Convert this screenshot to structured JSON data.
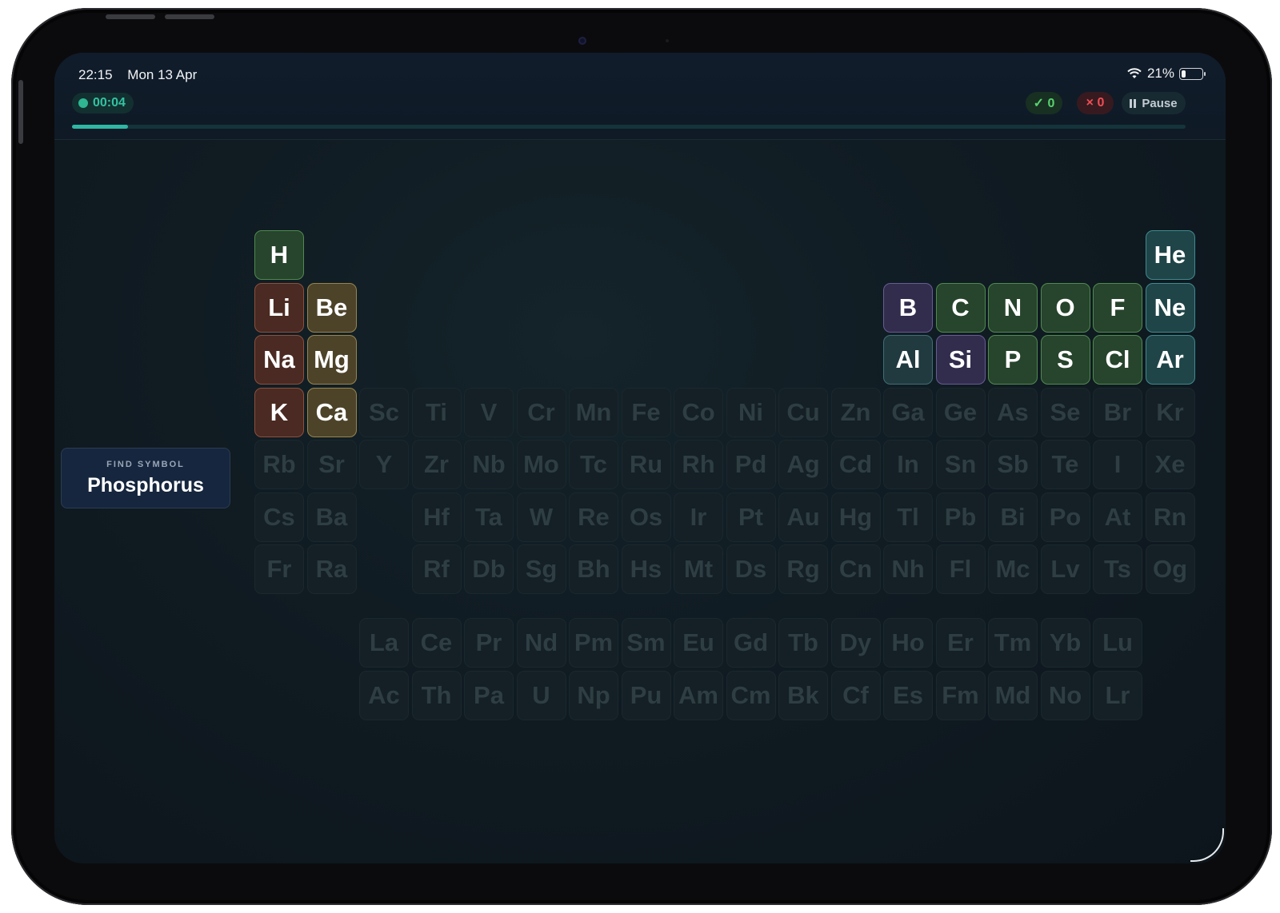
{
  "status": {
    "time": "22:15",
    "date": "Mon 13 Apr",
    "battery_percent": "21%",
    "battery_level": 0.21
  },
  "quiz": {
    "timer": "00:04",
    "correct": "✓ 0",
    "wrong": "× 0",
    "pause_label": "Pause",
    "progress": 0.05,
    "prompt_caption": "FIND SYMBOL",
    "prompt_name": "Phosphorus"
  },
  "colors": {
    "alkali": "#4a2a22",
    "alkaline_earth": "#4d4329",
    "nonmetal": "#27442c",
    "noble_gas": "#1f4548",
    "metalloid": "#322d4d",
    "post_transition": "#213a40",
    "accent": "#2fb7a3"
  },
  "elements": [
    {
      "s": "H",
      "r": 1,
      "c": 1,
      "cat": "nonm"
    },
    {
      "s": "He",
      "r": 1,
      "c": 18,
      "cat": "noble"
    },
    {
      "s": "Li",
      "r": 2,
      "c": 1,
      "cat": "alk"
    },
    {
      "s": "Be",
      "r": 2,
      "c": 2,
      "cat": "ae"
    },
    {
      "s": "B",
      "r": 2,
      "c": 13,
      "cat": "metalloid"
    },
    {
      "s": "C",
      "r": 2,
      "c": 14,
      "cat": "nonm"
    },
    {
      "s": "N",
      "r": 2,
      "c": 15,
      "cat": "nonm"
    },
    {
      "s": "O",
      "r": 2,
      "c": 16,
      "cat": "nonm"
    },
    {
      "s": "F",
      "r": 2,
      "c": 17,
      "cat": "nonm"
    },
    {
      "s": "Ne",
      "r": 2,
      "c": 18,
      "cat": "noble"
    },
    {
      "s": "Na",
      "r": 3,
      "c": 1,
      "cat": "alk"
    },
    {
      "s": "Mg",
      "r": 3,
      "c": 2,
      "cat": "ae"
    },
    {
      "s": "Al",
      "r": 3,
      "c": 13,
      "cat": "post"
    },
    {
      "s": "Si",
      "r": 3,
      "c": 14,
      "cat": "metalloid"
    },
    {
      "s": "P",
      "r": 3,
      "c": 15,
      "cat": "nonm"
    },
    {
      "s": "S",
      "r": 3,
      "c": 16,
      "cat": "nonm"
    },
    {
      "s": "Cl",
      "r": 3,
      "c": 17,
      "cat": "nonm"
    },
    {
      "s": "Ar",
      "r": 3,
      "c": 18,
      "cat": "noble"
    },
    {
      "s": "K",
      "r": 4,
      "c": 1,
      "cat": "alk"
    },
    {
      "s": "Ca",
      "r": 4,
      "c": 2,
      "cat": "ae"
    },
    {
      "s": "Sc",
      "r": 4,
      "c": 3,
      "cat": "ghost"
    },
    {
      "s": "Ti",
      "r": 4,
      "c": 4,
      "cat": "ghost"
    },
    {
      "s": "V",
      "r": 4,
      "c": 5,
      "cat": "ghost"
    },
    {
      "s": "Cr",
      "r": 4,
      "c": 6,
      "cat": "ghost"
    },
    {
      "s": "Mn",
      "r": 4,
      "c": 7,
      "cat": "ghost"
    },
    {
      "s": "Fe",
      "r": 4,
      "c": 8,
      "cat": "ghost"
    },
    {
      "s": "Co",
      "r": 4,
      "c": 9,
      "cat": "ghost"
    },
    {
      "s": "Ni",
      "r": 4,
      "c": 10,
      "cat": "ghost"
    },
    {
      "s": "Cu",
      "r": 4,
      "c": 11,
      "cat": "ghost"
    },
    {
      "s": "Zn",
      "r": 4,
      "c": 12,
      "cat": "ghost"
    },
    {
      "s": "Ga",
      "r": 4,
      "c": 13,
      "cat": "ghost"
    },
    {
      "s": "Ge",
      "r": 4,
      "c": 14,
      "cat": "ghost"
    },
    {
      "s": "As",
      "r": 4,
      "c": 15,
      "cat": "ghost"
    },
    {
      "s": "Se",
      "r": 4,
      "c": 16,
      "cat": "ghost"
    },
    {
      "s": "Br",
      "r": 4,
      "c": 17,
      "cat": "ghost"
    },
    {
      "s": "Kr",
      "r": 4,
      "c": 18,
      "cat": "ghost"
    },
    {
      "s": "Rb",
      "r": 5,
      "c": 1,
      "cat": "ghost"
    },
    {
      "s": "Sr",
      "r": 5,
      "c": 2,
      "cat": "ghost"
    },
    {
      "s": "Y",
      "r": 5,
      "c": 3,
      "cat": "ghost"
    },
    {
      "s": "Zr",
      "r": 5,
      "c": 4,
      "cat": "ghost"
    },
    {
      "s": "Nb",
      "r": 5,
      "c": 5,
      "cat": "ghost"
    },
    {
      "s": "Mo",
      "r": 5,
      "c": 6,
      "cat": "ghost"
    },
    {
      "s": "Tc",
      "r": 5,
      "c": 7,
      "cat": "ghost"
    },
    {
      "s": "Ru",
      "r": 5,
      "c": 8,
      "cat": "ghost"
    },
    {
      "s": "Rh",
      "r": 5,
      "c": 9,
      "cat": "ghost"
    },
    {
      "s": "Pd",
      "r": 5,
      "c": 10,
      "cat": "ghost"
    },
    {
      "s": "Ag",
      "r": 5,
      "c": 11,
      "cat": "ghost"
    },
    {
      "s": "Cd",
      "r": 5,
      "c": 12,
      "cat": "ghost"
    },
    {
      "s": "In",
      "r": 5,
      "c": 13,
      "cat": "ghost"
    },
    {
      "s": "Sn",
      "r": 5,
      "c": 14,
      "cat": "ghost"
    },
    {
      "s": "Sb",
      "r": 5,
      "c": 15,
      "cat": "ghost"
    },
    {
      "s": "Te",
      "r": 5,
      "c": 16,
      "cat": "ghost"
    },
    {
      "s": "I",
      "r": 5,
      "c": 17,
      "cat": "ghost"
    },
    {
      "s": "Xe",
      "r": 5,
      "c": 18,
      "cat": "ghost"
    },
    {
      "s": "Cs",
      "r": 6,
      "c": 1,
      "cat": "ghost"
    },
    {
      "s": "Ba",
      "r": 6,
      "c": 2,
      "cat": "ghost"
    },
    {
      "s": "Hf",
      "r": 6,
      "c": 4,
      "cat": "ghost"
    },
    {
      "s": "Ta",
      "r": 6,
      "c": 5,
      "cat": "ghost"
    },
    {
      "s": "W",
      "r": 6,
      "c": 6,
      "cat": "ghost"
    },
    {
      "s": "Re",
      "r": 6,
      "c": 7,
      "cat": "ghost"
    },
    {
      "s": "Os",
      "r": 6,
      "c": 8,
      "cat": "ghost"
    },
    {
      "s": "Ir",
      "r": 6,
      "c": 9,
      "cat": "ghost"
    },
    {
      "s": "Pt",
      "r": 6,
      "c": 10,
      "cat": "ghost"
    },
    {
      "s": "Au",
      "r": 6,
      "c": 11,
      "cat": "ghost"
    },
    {
      "s": "Hg",
      "r": 6,
      "c": 12,
      "cat": "ghost"
    },
    {
      "s": "Tl",
      "r": 6,
      "c": 13,
      "cat": "ghost"
    },
    {
      "s": "Pb",
      "r": 6,
      "c": 14,
      "cat": "ghost"
    },
    {
      "s": "Bi",
      "r": 6,
      "c": 15,
      "cat": "ghost"
    },
    {
      "s": "Po",
      "r": 6,
      "c": 16,
      "cat": "ghost"
    },
    {
      "s": "At",
      "r": 6,
      "c": 17,
      "cat": "ghost"
    },
    {
      "s": "Rn",
      "r": 6,
      "c": 18,
      "cat": "ghost"
    },
    {
      "s": "Fr",
      "r": 7,
      "c": 1,
      "cat": "ghost"
    },
    {
      "s": "Ra",
      "r": 7,
      "c": 2,
      "cat": "ghost"
    },
    {
      "s": "Rf",
      "r": 7,
      "c": 4,
      "cat": "ghost"
    },
    {
      "s": "Db",
      "r": 7,
      "c": 5,
      "cat": "ghost"
    },
    {
      "s": "Sg",
      "r": 7,
      "c": 6,
      "cat": "ghost"
    },
    {
      "s": "Bh",
      "r": 7,
      "c": 7,
      "cat": "ghost"
    },
    {
      "s": "Hs",
      "r": 7,
      "c": 8,
      "cat": "ghost"
    },
    {
      "s": "Mt",
      "r": 7,
      "c": 9,
      "cat": "ghost"
    },
    {
      "s": "Ds",
      "r": 7,
      "c": 10,
      "cat": "ghost"
    },
    {
      "s": "Rg",
      "r": 7,
      "c": 11,
      "cat": "ghost"
    },
    {
      "s": "Cn",
      "r": 7,
      "c": 12,
      "cat": "ghost"
    },
    {
      "s": "Nh",
      "r": 7,
      "c": 13,
      "cat": "ghost"
    },
    {
      "s": "Fl",
      "r": 7,
      "c": 14,
      "cat": "ghost"
    },
    {
      "s": "Mc",
      "r": 7,
      "c": 15,
      "cat": "ghost"
    },
    {
      "s": "Lv",
      "r": 7,
      "c": 16,
      "cat": "ghost"
    },
    {
      "s": "Ts",
      "r": 7,
      "c": 17,
      "cat": "ghost"
    },
    {
      "s": "Og",
      "r": 7,
      "c": 18,
      "cat": "ghost"
    },
    {
      "s": "La",
      "r": 8,
      "c": 3,
      "cat": "ghost"
    },
    {
      "s": "Ce",
      "r": 8,
      "c": 4,
      "cat": "ghost"
    },
    {
      "s": "Pr",
      "r": 8,
      "c": 5,
      "cat": "ghost"
    },
    {
      "s": "Nd",
      "r": 8,
      "c": 6,
      "cat": "ghost"
    },
    {
      "s": "Pm",
      "r": 8,
      "c": 7,
      "cat": "ghost"
    },
    {
      "s": "Sm",
      "r": 8,
      "c": 8,
      "cat": "ghost"
    },
    {
      "s": "Eu",
      "r": 8,
      "c": 9,
      "cat": "ghost"
    },
    {
      "s": "Gd",
      "r": 8,
      "c": 10,
      "cat": "ghost"
    },
    {
      "s": "Tb",
      "r": 8,
      "c": 11,
      "cat": "ghost"
    },
    {
      "s": "Dy",
      "r": 8,
      "c": 12,
      "cat": "ghost"
    },
    {
      "s": "Ho",
      "r": 8,
      "c": 13,
      "cat": "ghost"
    },
    {
      "s": "Er",
      "r": 8,
      "c": 14,
      "cat": "ghost"
    },
    {
      "s": "Tm",
      "r": 8,
      "c": 15,
      "cat": "ghost"
    },
    {
      "s": "Yb",
      "r": 8,
      "c": 16,
      "cat": "ghost"
    },
    {
      "s": "Lu",
      "r": 8,
      "c": 17,
      "cat": "ghost"
    },
    {
      "s": "Ac",
      "r": 9,
      "c": 3,
      "cat": "ghost"
    },
    {
      "s": "Th",
      "r": 9,
      "c": 4,
      "cat": "ghost"
    },
    {
      "s": "Pa",
      "r": 9,
      "c": 5,
      "cat": "ghost"
    },
    {
      "s": "U",
      "r": 9,
      "c": 6,
      "cat": "ghost"
    },
    {
      "s": "Np",
      "r": 9,
      "c": 7,
      "cat": "ghost"
    },
    {
      "s": "Pu",
      "r": 9,
      "c": 8,
      "cat": "ghost"
    },
    {
      "s": "Am",
      "r": 9,
      "c": 9,
      "cat": "ghost"
    },
    {
      "s": "Cm",
      "r": 9,
      "c": 10,
      "cat": "ghost"
    },
    {
      "s": "Bk",
      "r": 9,
      "c": 11,
      "cat": "ghost"
    },
    {
      "s": "Cf",
      "r": 9,
      "c": 12,
      "cat": "ghost"
    },
    {
      "s": "Es",
      "r": 9,
      "c": 13,
      "cat": "ghost"
    },
    {
      "s": "Fm",
      "r": 9,
      "c": 14,
      "cat": "ghost"
    },
    {
      "s": "Md",
      "r": 9,
      "c": 15,
      "cat": "ghost"
    },
    {
      "s": "No",
      "r": 9,
      "c": 16,
      "cat": "ghost"
    },
    {
      "s": "Lr",
      "r": 9,
      "c": 17,
      "cat": "ghost"
    }
  ]
}
